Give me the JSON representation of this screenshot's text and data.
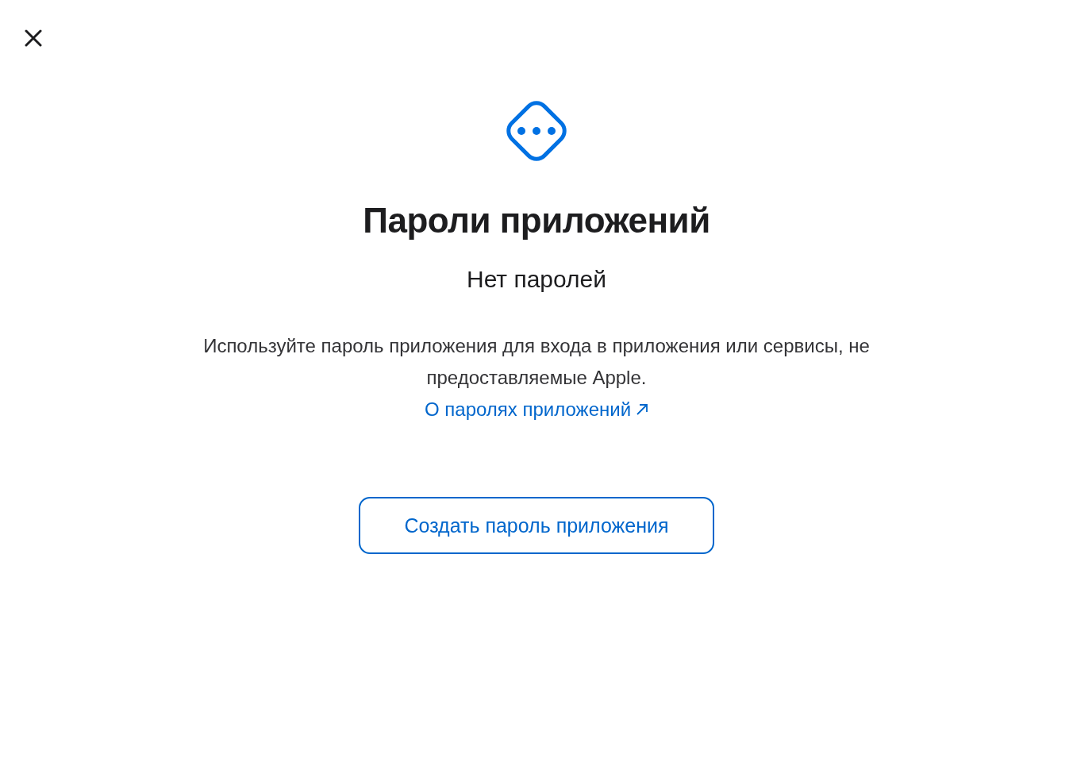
{
  "title": "Пароли приложений",
  "subtitle": "Нет паролей",
  "description": "Используйте пароль приложения для входа в приложения или сервисы, не предоставляемые Apple.",
  "link": "О паролях приложений",
  "button": "Создать пароль приложения"
}
